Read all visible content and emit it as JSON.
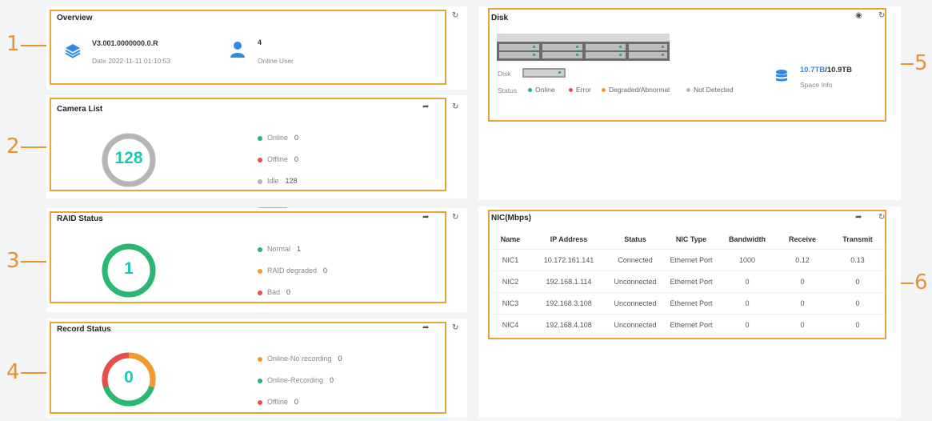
{
  "callouts": [
    "1",
    "2",
    "3",
    "4",
    "5",
    "6"
  ],
  "overview": {
    "title": "Overview",
    "version": "V3.001.0000000.0.R",
    "date": "Date 2022-11-11 01:10:53",
    "online_count": "4",
    "online_label": "Online User"
  },
  "camera": {
    "title": "Camera List",
    "total": "128",
    "legend": [
      {
        "label": "Online",
        "value": "0",
        "color": "#2bb673"
      },
      {
        "label": "Offline",
        "value": "0",
        "color": "#e84d4d"
      },
      {
        "label": "Idle",
        "value": "128",
        "color": "#b5b5b5"
      }
    ]
  },
  "raid": {
    "title": "RAID Status",
    "total": "1",
    "legend": [
      {
        "label": "Normal",
        "value": "1",
        "color": "#2bb673"
      },
      {
        "label": "RAID degraded",
        "value": "0",
        "color": "#f39a2b"
      },
      {
        "label": "Bad",
        "value": "0",
        "color": "#e84d4d"
      }
    ]
  },
  "record": {
    "title": "Record Status",
    "total": "0",
    "legend": [
      {
        "label": "Online-No recording",
        "value": "0",
        "color": "#f39a2b"
      },
      {
        "label": "Online-Recording",
        "value": "0",
        "color": "#2bb673"
      },
      {
        "label": "Offline",
        "value": "0",
        "color": "#e84d4d"
      }
    ]
  },
  "disk": {
    "title": "Disk",
    "disk_label": "Disk",
    "status_label": "Status",
    "statuses": [
      {
        "label": "Online",
        "color": "#2bb673"
      },
      {
        "label": "Error",
        "color": "#e84d4d"
      },
      {
        "label": "Degraded/Abnormal",
        "color": "#f39a2b"
      },
      {
        "label": "Not Detected",
        "color": "#b5b5b5"
      }
    ],
    "space_used": "10.7TB",
    "space_total": "/10.9TB",
    "space_label": "Space Info"
  },
  "nic": {
    "title": "NIC(Mbps)",
    "columns": [
      "Name",
      "IP Address",
      "Status",
      "NIC Type",
      "Bandwidth",
      "Receive",
      "Transmit"
    ],
    "rows": [
      [
        "NIC1",
        "10.172.161.141",
        "Connected",
        "Ethernet Port",
        "1000",
        "0.12",
        "0.13"
      ],
      [
        "NIC2",
        "192.168.1.114",
        "Unconnected",
        "Ethernet Port",
        "0",
        "0",
        "0"
      ],
      [
        "NIC3",
        "192.168.3.108",
        "Unconnected",
        "Ethernet Port",
        "0",
        "0",
        "0"
      ],
      [
        "NIC4",
        "192.168.4.108",
        "Unconnected",
        "Ethernet Port",
        "0",
        "0",
        "0"
      ]
    ]
  },
  "colors": {
    "accent": "#e8a33b",
    "teal": "#1cc7b6",
    "green": "#2bb673",
    "orange": "#f39a2b",
    "red": "#e84d4d",
    "blue": "#2e8ae6",
    "gray": "#b5b5b5"
  }
}
